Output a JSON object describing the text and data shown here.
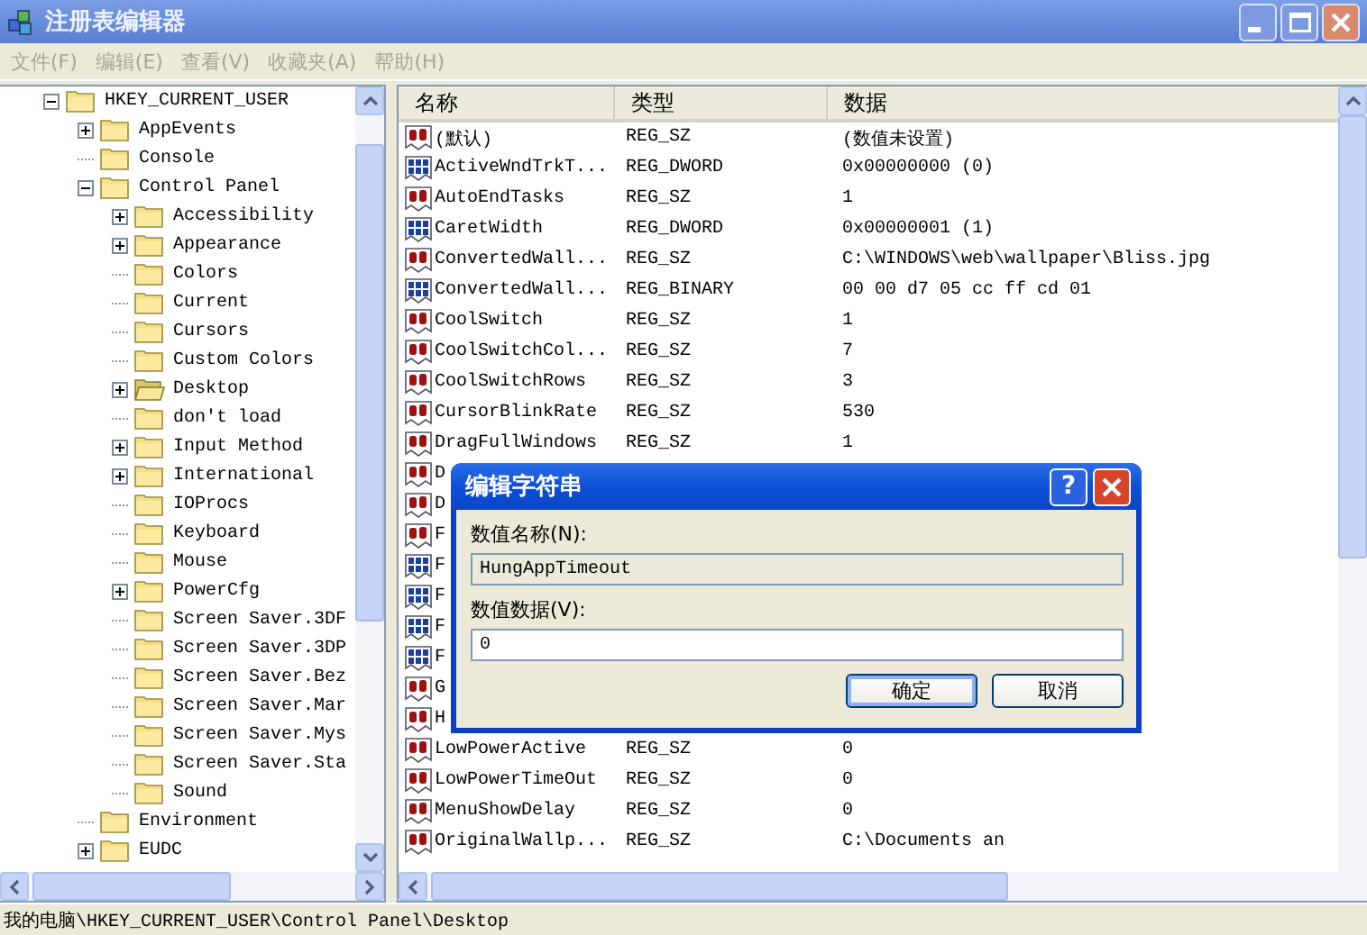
{
  "window": {
    "title": "注册表编辑器"
  },
  "menu": [
    {
      "label": "文件(F)",
      "disabled": true
    },
    {
      "label": "编辑(E)",
      "disabled": true
    },
    {
      "label": "查看(V)",
      "disabled": true
    },
    {
      "label": "收藏夹(A)",
      "disabled": true
    },
    {
      "label": "帮助(H)",
      "disabled": true
    }
  ],
  "tree": [
    {
      "label": "HKEY_CURRENT_USER",
      "kind": "expanded",
      "selected": false,
      "children": [
        {
          "label": "AppEvents",
          "kind": "collapsed",
          "selected": false
        },
        {
          "label": "Console",
          "kind": "leaf",
          "selected": false
        },
        {
          "label": "Control Panel",
          "kind": "expanded",
          "selected": false,
          "children": [
            {
              "label": "Accessibility",
              "kind": "collapsed",
              "selected": false
            },
            {
              "label": "Appearance",
              "kind": "collapsed",
              "selected": false
            },
            {
              "label": "Colors",
              "kind": "leaf",
              "selected": false
            },
            {
              "label": "Current",
              "kind": "leaf",
              "selected": false
            },
            {
              "label": "Cursors",
              "kind": "leaf",
              "selected": false
            },
            {
              "label": "Custom Colors",
              "kind": "leaf",
              "selected": false
            },
            {
              "label": "Desktop",
              "kind": "collapsed",
              "selected": true
            },
            {
              "label": "don't load",
              "kind": "leaf",
              "selected": false
            },
            {
              "label": "Input Method",
              "kind": "collapsed",
              "selected": false
            },
            {
              "label": "International",
              "kind": "collapsed",
              "selected": false
            },
            {
              "label": "IOProcs",
              "kind": "leaf",
              "selected": false
            },
            {
              "label": "Keyboard",
              "kind": "leaf",
              "selected": false
            },
            {
              "label": "Mouse",
              "kind": "leaf",
              "selected": false
            },
            {
              "label": "PowerCfg",
              "kind": "collapsed",
              "selected": false
            },
            {
              "label": "Screen Saver.3DF",
              "kind": "leaf",
              "selected": false
            },
            {
              "label": "Screen Saver.3DP",
              "kind": "leaf",
              "selected": false
            },
            {
              "label": "Screen Saver.Bez",
              "kind": "leaf",
              "selected": false
            },
            {
              "label": "Screen Saver.Mar",
              "kind": "leaf",
              "selected": false
            },
            {
              "label": "Screen Saver.Mys",
              "kind": "leaf",
              "selected": false
            },
            {
              "label": "Screen Saver.Sta",
              "kind": "leaf",
              "selected": false
            },
            {
              "label": "Sound",
              "kind": "leaf",
              "selected": false
            }
          ]
        },
        {
          "label": "Environment",
          "kind": "leaf",
          "selected": false
        },
        {
          "label": "EUDC",
          "kind": "collapsed",
          "selected": false
        }
      ]
    }
  ],
  "table": {
    "columns": [
      "名称",
      "类型",
      "数据"
    ],
    "rows": [
      {
        "kind": "sz",
        "name": "(默认)",
        "type": "REG_SZ",
        "data": "(数值未设置)"
      },
      {
        "kind": "binary",
        "name": "ActiveWndTrkT...",
        "type": "REG_DWORD",
        "data": "0x00000000 (0)"
      },
      {
        "kind": "sz",
        "name": "AutoEndTasks",
        "type": "REG_SZ",
        "data": "1"
      },
      {
        "kind": "binary",
        "name": "CaretWidth",
        "type": "REG_DWORD",
        "data": "0x00000001 (1)"
      },
      {
        "kind": "sz",
        "name": "ConvertedWall...",
        "type": "REG_SZ",
        "data": "C:\\WINDOWS\\web\\wallpaper\\Bliss.jpg"
      },
      {
        "kind": "binary",
        "name": "ConvertedWall...",
        "type": "REG_BINARY",
        "data": "00 00 d7 05 cc ff cd 01"
      },
      {
        "kind": "sz",
        "name": "CoolSwitch",
        "type": "REG_SZ",
        "data": "1"
      },
      {
        "kind": "sz",
        "name": "CoolSwitchCol...",
        "type": "REG_SZ",
        "data": "7"
      },
      {
        "kind": "sz",
        "name": "CoolSwitchRows",
        "type": "REG_SZ",
        "data": "3"
      },
      {
        "kind": "sz",
        "name": "CursorBlinkRate",
        "type": "REG_SZ",
        "data": "530"
      },
      {
        "kind": "sz",
        "name": "DragFullWindows",
        "type": "REG_SZ",
        "data": "1"
      },
      {
        "kind": "sz",
        "name": "D"
      },
      {
        "kind": "sz",
        "name": "D"
      },
      {
        "kind": "sz",
        "name": "F"
      },
      {
        "kind": "binary",
        "name": "F"
      },
      {
        "kind": "binary",
        "name": "F"
      },
      {
        "kind": "binary",
        "name": "F"
      },
      {
        "kind": "binary",
        "name": "F"
      },
      {
        "kind": "sz",
        "name": "G"
      },
      {
        "kind": "sz",
        "name": "H"
      },
      {
        "kind": "sz",
        "name": "LowPowerActive",
        "type": "REG_SZ",
        "data": "0"
      },
      {
        "kind": "sz",
        "name": "LowPowerTimeOut",
        "type": "REG_SZ",
        "data": "0"
      },
      {
        "kind": "sz",
        "name": "MenuShowDelay",
        "type": "REG_SZ",
        "data": "0"
      },
      {
        "kind": "sz",
        "name": "OriginalWallp...",
        "type": "REG_SZ",
        "data": "C:\\Documents an"
      }
    ]
  },
  "dialog": {
    "title": "编辑字符串",
    "help": "?",
    "name_label": "数值名称(N):",
    "name_value": "HungAppTimeout",
    "data_label": "数值数据(V):",
    "data_value": "0",
    "buttons": [
      {
        "label": "确定",
        "default": true
      },
      {
        "label": "取消",
        "default": false
      }
    ]
  },
  "status_bar": "我的电脑\\HKEY_CURRENT_USER\\Control Panel\\Desktop"
}
